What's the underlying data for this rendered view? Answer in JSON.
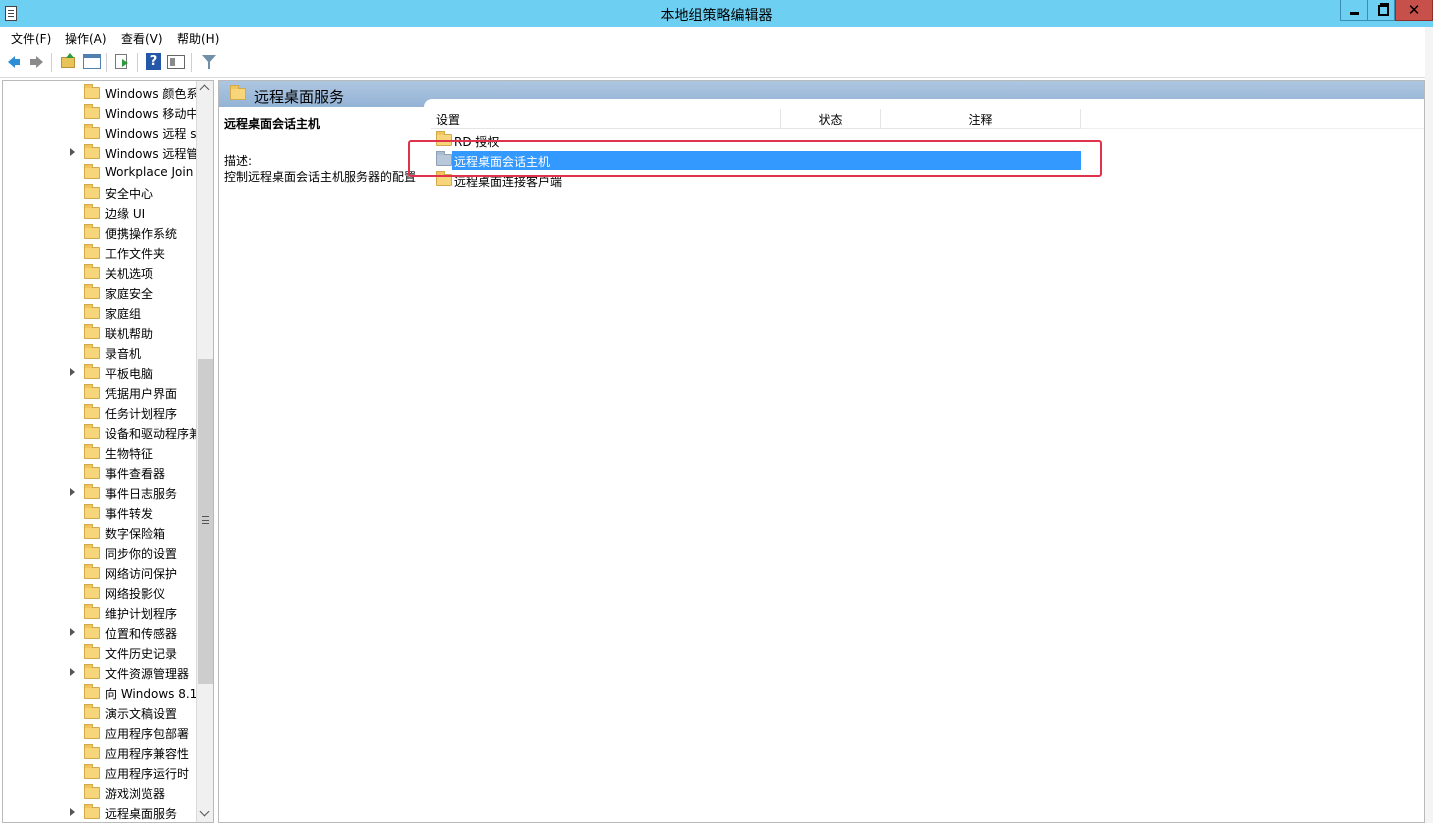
{
  "window": {
    "title": "本地组策略编辑器",
    "close_glyph": "✕"
  },
  "menu": {
    "items": [
      "文件(F)",
      "操作(A)",
      "查看(V)",
      "帮助(H)"
    ]
  },
  "toolbar": {
    "buttons": [
      "back-icon",
      "forward-icon",
      "folder-up-icon",
      "show-hide-tree-icon",
      "export-list-icon",
      "help-icon",
      "properties-icon",
      "filter-icon"
    ],
    "help_glyph": "?"
  },
  "tree": {
    "items": [
      {
        "label": "Windows 颜色系",
        "expandable": false
      },
      {
        "label": "Windows 移动中",
        "expandable": false
      },
      {
        "label": "Windows 远程 s",
        "expandable": false
      },
      {
        "label": "Windows 远程管",
        "expandable": true
      },
      {
        "label": "Workplace Join",
        "expandable": false
      },
      {
        "label": "安全中心",
        "expandable": false
      },
      {
        "label": "边缘 UI",
        "expandable": false
      },
      {
        "label": "便携操作系统",
        "expandable": false
      },
      {
        "label": "工作文件夹",
        "expandable": false
      },
      {
        "label": "关机选项",
        "expandable": false
      },
      {
        "label": "家庭安全",
        "expandable": false
      },
      {
        "label": "家庭组",
        "expandable": false
      },
      {
        "label": "联机帮助",
        "expandable": false
      },
      {
        "label": "录音机",
        "expandable": false
      },
      {
        "label": "平板电脑",
        "expandable": true
      },
      {
        "label": "凭据用户界面",
        "expandable": false
      },
      {
        "label": "任务计划程序",
        "expandable": false
      },
      {
        "label": "设备和驱动程序兼",
        "expandable": false
      },
      {
        "label": "生物特征",
        "expandable": false
      },
      {
        "label": "事件查看器",
        "expandable": false
      },
      {
        "label": "事件日志服务",
        "expandable": true
      },
      {
        "label": "事件转发",
        "expandable": false
      },
      {
        "label": "数字保险箱",
        "expandable": false
      },
      {
        "label": "同步你的设置",
        "expandable": false
      },
      {
        "label": "网络访问保护",
        "expandable": false
      },
      {
        "label": "网络投影仪",
        "expandable": false
      },
      {
        "label": "维护计划程序",
        "expandable": false
      },
      {
        "label": "位置和传感器",
        "expandable": true
      },
      {
        "label": "文件历史记录",
        "expandable": false
      },
      {
        "label": "文件资源管理器",
        "expandable": true
      },
      {
        "label": "向 Windows 8.1",
        "expandable": false
      },
      {
        "label": "演示文稿设置",
        "expandable": false
      },
      {
        "label": "应用程序包部署",
        "expandable": false
      },
      {
        "label": "应用程序兼容性",
        "expandable": false
      },
      {
        "label": "应用程序运行时",
        "expandable": false
      },
      {
        "label": "游戏浏览器",
        "expandable": false
      },
      {
        "label": "远程桌面服务",
        "expandable": true
      }
    ]
  },
  "right": {
    "header_title": "远程桌面服务",
    "description": {
      "heading": "远程桌面会话主机",
      "label": "描述:",
      "text": "控制远程桌面会话主机服务器的配置"
    },
    "columns": {
      "setting": "设置",
      "state": "状态",
      "note": "注释"
    },
    "rows": [
      {
        "label": "RD 授权",
        "selected": false
      },
      {
        "label": "远程桌面会话主机",
        "selected": true
      },
      {
        "label": "远程桌面连接客户端",
        "selected": false
      }
    ]
  },
  "colors": {
    "titlebar": "#6dcff2",
    "selection": "#3399ff",
    "highlight_box": "#e0324a",
    "folder": "#f7d57b"
  }
}
